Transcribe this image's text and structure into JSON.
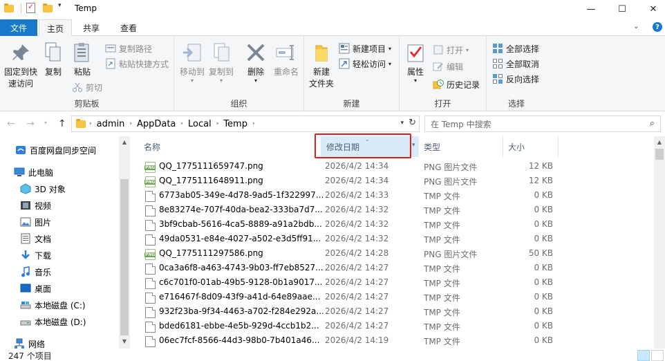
{
  "window": {
    "title": "Temp",
    "minimize": "—",
    "maximize": "☐",
    "close": "✕"
  },
  "ribbon_tabs": {
    "file": "文件",
    "home": "主页",
    "share": "共享",
    "view": "查看"
  },
  "ribbon": {
    "clipboard": {
      "label": "剪贴板",
      "pin": "固定到快",
      "pin2": "速访问",
      "copy": "复制",
      "paste": "粘贴",
      "copy_path": "复制路径",
      "paste_shortcut": "粘贴快捷方式",
      "cut": "剪切"
    },
    "organize": {
      "label": "组织",
      "move_to": "移动到",
      "copy_to": "复制到",
      "delete": "删除",
      "rename": "重命名"
    },
    "new": {
      "label": "新建",
      "new_folder": "新建",
      "new_folder2": "文件夹",
      "new_item": "新建项目",
      "easy_access": "轻松访问"
    },
    "open": {
      "label": "打开",
      "properties": "属性",
      "open": "打开",
      "edit": "编辑",
      "history": "历史记录"
    },
    "select": {
      "label": "选择",
      "select_all": "全部选择",
      "select_none": "全部取消",
      "invert": "反向选择"
    }
  },
  "address": {
    "crumbs": [
      "admin",
      "AppData",
      "Local",
      "Temp"
    ],
    "search_placeholder": "在 Temp 中搜索"
  },
  "nav_pane": {
    "items": [
      {
        "label": "百度网盘同步空间",
        "icon": "baidu-cloud-icon"
      },
      {
        "label": "此电脑",
        "icon": "this-pc-icon"
      },
      {
        "label": "3D 对象",
        "icon": "3d-objects-icon"
      },
      {
        "label": "视频",
        "icon": "video-icon"
      },
      {
        "label": "图片",
        "icon": "pictures-icon"
      },
      {
        "label": "文档",
        "icon": "documents-icon"
      },
      {
        "label": "下载",
        "icon": "downloads-icon"
      },
      {
        "label": "音乐",
        "icon": "music-icon"
      },
      {
        "label": "桌面",
        "icon": "desktop-icon"
      },
      {
        "label": "本地磁盘 (C:)",
        "icon": "drive-c-icon"
      },
      {
        "label": "本地磁盘 (D:)",
        "icon": "drive-d-icon"
      },
      {
        "label": "网络",
        "icon": "network-icon"
      }
    ]
  },
  "columns": {
    "name": "名称",
    "date": "修改日期",
    "type": "类型",
    "size": "大小"
  },
  "files": [
    {
      "name": "QQ_1775111659747.png",
      "date": "2026/4/2 14:34",
      "type": "PNG 图片文件",
      "size": "12 KB",
      "icon": "png"
    },
    {
      "name": "QQ_1775111648911.png",
      "date": "2026/4/2 14:34",
      "type": "PNG 图片文件",
      "size": "12 KB",
      "icon": "png"
    },
    {
      "name": "6773ab05-349e-4d78-9ad5-1f322997...",
      "date": "2026/4/2 14:33",
      "type": "TMP 文件",
      "size": "0 KB",
      "icon": "tmp"
    },
    {
      "name": "8e83274e-707f-40da-bea2-333ba7d7...",
      "date": "2026/4/2 14:32",
      "type": "TMP 文件",
      "size": "0 KB",
      "icon": "tmp"
    },
    {
      "name": "3bf9cbab-5616-4ca5-8889-a91a2bdb...",
      "date": "2026/4/2 14:32",
      "type": "TMP 文件",
      "size": "0 KB",
      "icon": "tmp"
    },
    {
      "name": "49da0531-e84e-4027-a502-e3d5ff91...",
      "date": "2026/4/2 14:32",
      "type": "TMP 文件",
      "size": "0 KB",
      "icon": "tmp"
    },
    {
      "name": "QQ_1775111297586.png",
      "date": "2026/4/2 14:28",
      "type": "PNG 图片文件",
      "size": "50 KB",
      "icon": "png"
    },
    {
      "name": "0ca3a6f8-a463-4743-9b03-ff7eb8527...",
      "date": "2026/4/2 14:27",
      "type": "TMP 文件",
      "size": "0 KB",
      "icon": "tmp"
    },
    {
      "name": "c6c701f0-01ab-49b5-9128-0b1a9017...",
      "date": "2026/4/2 14:27",
      "type": "TMP 文件",
      "size": "0 KB",
      "icon": "tmp"
    },
    {
      "name": "e716467f-8d09-43f9-a41d-64e89aae...",
      "date": "2026/4/2 14:27",
      "type": "TMP 文件",
      "size": "0 KB",
      "icon": "tmp"
    },
    {
      "name": "932f23ba-9f34-4463-a702-f284e292a...",
      "date": "2026/4/2 14:27",
      "type": "TMP 文件",
      "size": "0 KB",
      "icon": "tmp"
    },
    {
      "name": "bded6181-ebbe-4e5b-929d-4ccb1b2...",
      "date": "2026/4/2 14:27",
      "type": "TMP 文件",
      "size": "0 KB",
      "icon": "tmp"
    },
    {
      "name": "06ec7fcf-8566-44d3-98b0-7b401a46...",
      "date": "2026/4/2 14:19",
      "type": "TMP 文件",
      "size": "0 KB",
      "icon": "tmp"
    }
  ],
  "status": {
    "count": "247 个项目"
  }
}
